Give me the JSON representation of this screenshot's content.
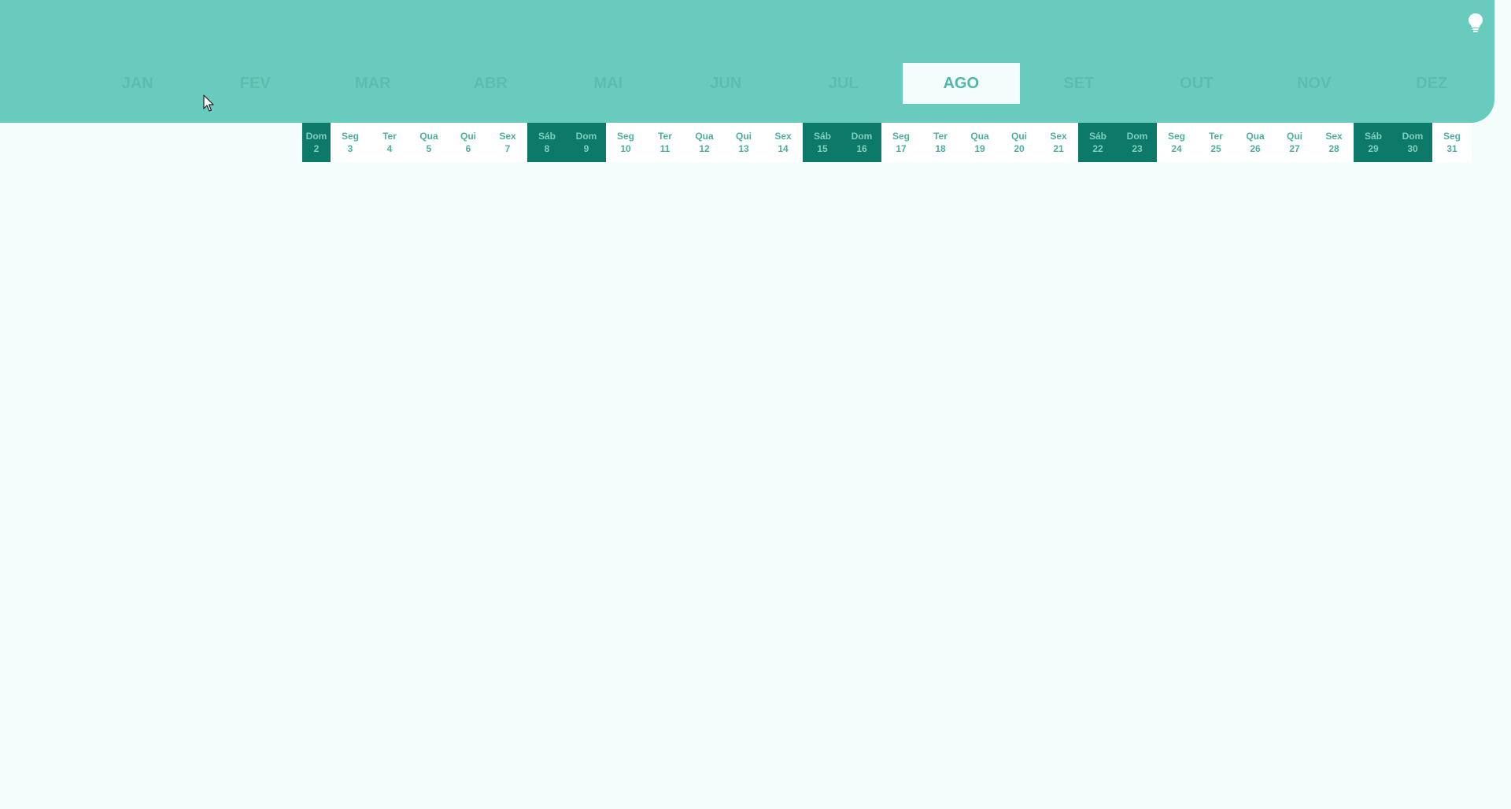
{
  "months": [
    {
      "label": "JAN",
      "active": false
    },
    {
      "label": "FEV",
      "active": false
    },
    {
      "label": "MAR",
      "active": false
    },
    {
      "label": "ABR",
      "active": false
    },
    {
      "label": "MAI",
      "active": false
    },
    {
      "label": "JUN",
      "active": false
    },
    {
      "label": "JUL",
      "active": false
    },
    {
      "label": "AGO",
      "active": true
    },
    {
      "label": "SET",
      "active": false
    },
    {
      "label": "OUT",
      "active": false
    },
    {
      "label": "NOV",
      "active": false
    },
    {
      "label": "DEZ",
      "active": false
    }
  ],
  "days": [
    {
      "weekday": "Dom",
      "num": "2",
      "weekend": true
    },
    {
      "weekday": "Seg",
      "num": "3",
      "weekend": false
    },
    {
      "weekday": "Ter",
      "num": "4",
      "weekend": false
    },
    {
      "weekday": "Qua",
      "num": "5",
      "weekend": false
    },
    {
      "weekday": "Qui",
      "num": "6",
      "weekend": false
    },
    {
      "weekday": "Sex",
      "num": "7",
      "weekend": false
    },
    {
      "weekday": "Sáb",
      "num": "8",
      "weekend": true
    },
    {
      "weekday": "Dom",
      "num": "9",
      "weekend": true
    },
    {
      "weekday": "Seg",
      "num": "10",
      "weekend": false
    },
    {
      "weekday": "Ter",
      "num": "11",
      "weekend": false
    },
    {
      "weekday": "Qua",
      "num": "12",
      "weekend": false
    },
    {
      "weekday": "Qui",
      "num": "13",
      "weekend": false
    },
    {
      "weekday": "Sex",
      "num": "14",
      "weekend": false
    },
    {
      "weekday": "Sáb",
      "num": "15",
      "weekend": true
    },
    {
      "weekday": "Dom",
      "num": "16",
      "weekend": true
    },
    {
      "weekday": "Seg",
      "num": "17",
      "weekend": false
    },
    {
      "weekday": "Ter",
      "num": "18",
      "weekend": false
    },
    {
      "weekday": "Qua",
      "num": "19",
      "weekend": false
    },
    {
      "weekday": "Qui",
      "num": "20",
      "weekend": false
    },
    {
      "weekday": "Sex",
      "num": "21",
      "weekend": false
    },
    {
      "weekday": "Sáb",
      "num": "22",
      "weekend": true
    },
    {
      "weekday": "Dom",
      "num": "23",
      "weekend": true
    },
    {
      "weekday": "Seg",
      "num": "24",
      "weekend": false
    },
    {
      "weekday": "Ter",
      "num": "25",
      "weekend": false
    },
    {
      "weekday": "Qua",
      "num": "26",
      "weekend": false
    },
    {
      "weekday": "Qui",
      "num": "27",
      "weekend": false
    },
    {
      "weekday": "Sex",
      "num": "28",
      "weekend": false
    },
    {
      "weekday": "Sáb",
      "num": "29",
      "weekend": true
    },
    {
      "weekday": "Dom",
      "num": "30",
      "weekend": true
    },
    {
      "weekday": "Seg",
      "num": "31",
      "weekend": false
    }
  ],
  "colors": {
    "header": "#69cbbd",
    "weekend": "#0d7a69",
    "background": "#f4fcfc"
  },
  "icons": {
    "theme_toggle": "lightbulb-icon"
  }
}
